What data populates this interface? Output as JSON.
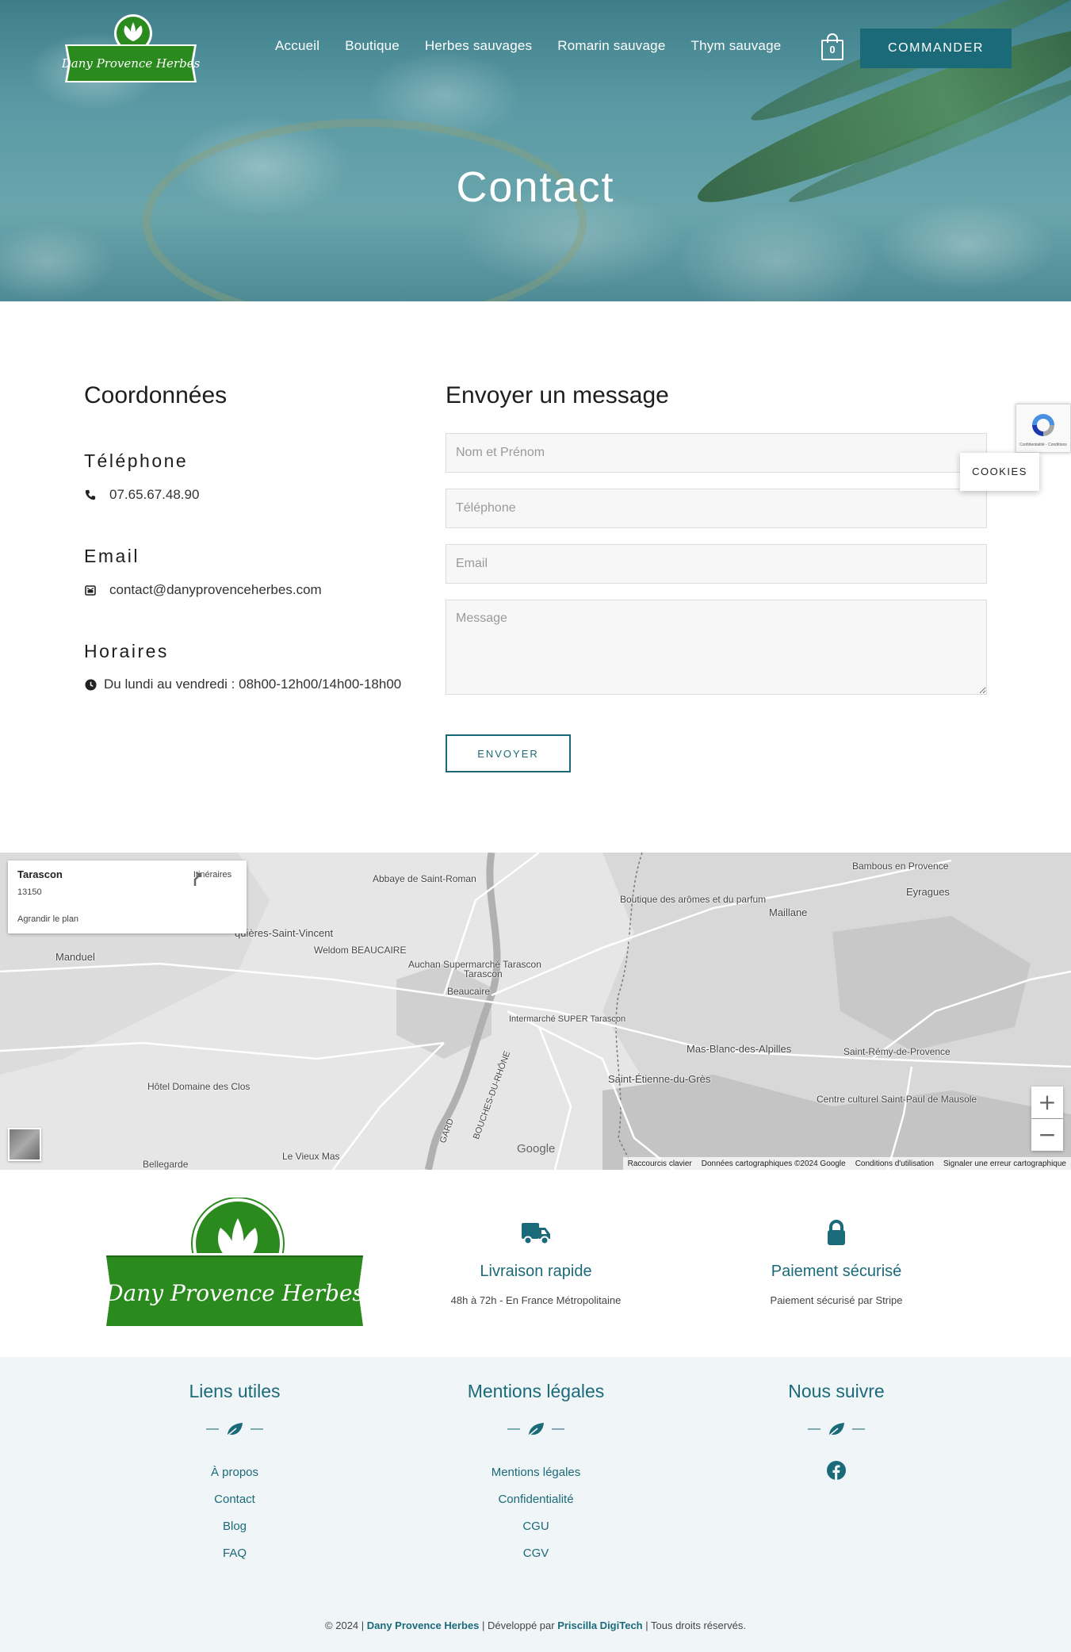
{
  "header": {
    "logo_text": "Dany Provence Herbes",
    "nav": [
      "Accueil",
      "Boutique",
      "Herbes sauvages",
      "Romarin sauvage",
      "Thym sauvage"
    ],
    "cart_count": "0",
    "cta_label": "COMMANDER",
    "page_title": "Contact"
  },
  "contact": {
    "coord_title": "Coordonnées",
    "phone_title": "Téléphone",
    "phone": "07.65.67.48.90",
    "email_title": "Email",
    "email": "contact@danyprovenceherbes.com",
    "hours_title": "Horaires",
    "hours": "Du lundi au vendredi : 08h00-12h00/14h00-18h00"
  },
  "form": {
    "title": "Envoyer un message",
    "name_placeholder": "Nom et Prénom",
    "phone_placeholder": "Téléphone",
    "email_placeholder": "Email",
    "message_placeholder": "Message",
    "submit_label": "ENVOYER"
  },
  "widgets": {
    "recaptcha_text": "Confidentialité - Conditions",
    "cookies_label": "COOKIES"
  },
  "map": {
    "place_name": "Tarascon",
    "postcode": "13150",
    "directions_label": "Itinéraires",
    "enlarge_label": "Agrandir le plan",
    "zoom_in": "+",
    "zoom_out": "−",
    "google_label": "Google",
    "footer_links": [
      "Raccourcis clavier",
      "Données cartographiques ©2024 Google",
      "Conditions d'utilisation",
      "Signaler une erreur cartographique"
    ],
    "labels": [
      {
        "text": "Abbaye de Saint-Roman"
      },
      {
        "text": "Bambous en Provence"
      },
      {
        "text": "Eyragues"
      },
      {
        "text": "Boutique des arômes et du parfum"
      },
      {
        "text": "Maillane"
      },
      {
        "text": "quières-Saint-Vincent"
      },
      {
        "text": "Manduel"
      },
      {
        "text": "Weldom BEAUCAIRE"
      },
      {
        "text": "Auchan Supermarché Tarascon"
      },
      {
        "text": "Beaucaire"
      },
      {
        "text": "Tarascon"
      },
      {
        "text": "Intermarché SUPER Tarascon"
      },
      {
        "text": "Mas-Blanc-des-Alpilles"
      },
      {
        "text": "Saint-Rémy-de-Provence"
      },
      {
        "text": "Saint-Étienne-du-Grès"
      },
      {
        "text": "Hôtel Domaine des Clos"
      },
      {
        "text": "Centre culturel Saint-Paul de Mausole"
      },
      {
        "text": "Bellegarde"
      },
      {
        "text": "Le Vieux Mas"
      },
      {
        "text": "GARD"
      },
      {
        "text": "BOUCHES-DU-RHÔNE"
      }
    ]
  },
  "features": [
    {
      "icon": "truck-icon",
      "title": "Livraison rapide",
      "desc": "48h à 72h - En France Métropolitaine"
    },
    {
      "icon": "lock-icon",
      "title": "Paiement sécurisé",
      "desc": "Paiement sécurisé par Stripe"
    }
  ],
  "footer": {
    "useful_title": "Liens utiles",
    "useful_links": [
      "À propos",
      "Contact",
      "Blog",
      "FAQ"
    ],
    "legal_title": "Mentions légales",
    "legal_links": [
      "Mentions légales",
      "Confidentialité",
      "CGU",
      "CGV"
    ],
    "follow_title": "Nous suivre",
    "copyright_prefix": "© 2024 |",
    "brand": "Dany Provence Herbes",
    "dev_prefix": "| Développé par",
    "developer": "Priscilla DigiTech",
    "rights": "| Tous droits réservés."
  },
  "colors": {
    "accent": "#1b6a7a",
    "logo_green": "#2a8a1e",
    "footer_bg": "#f0f5f7"
  }
}
